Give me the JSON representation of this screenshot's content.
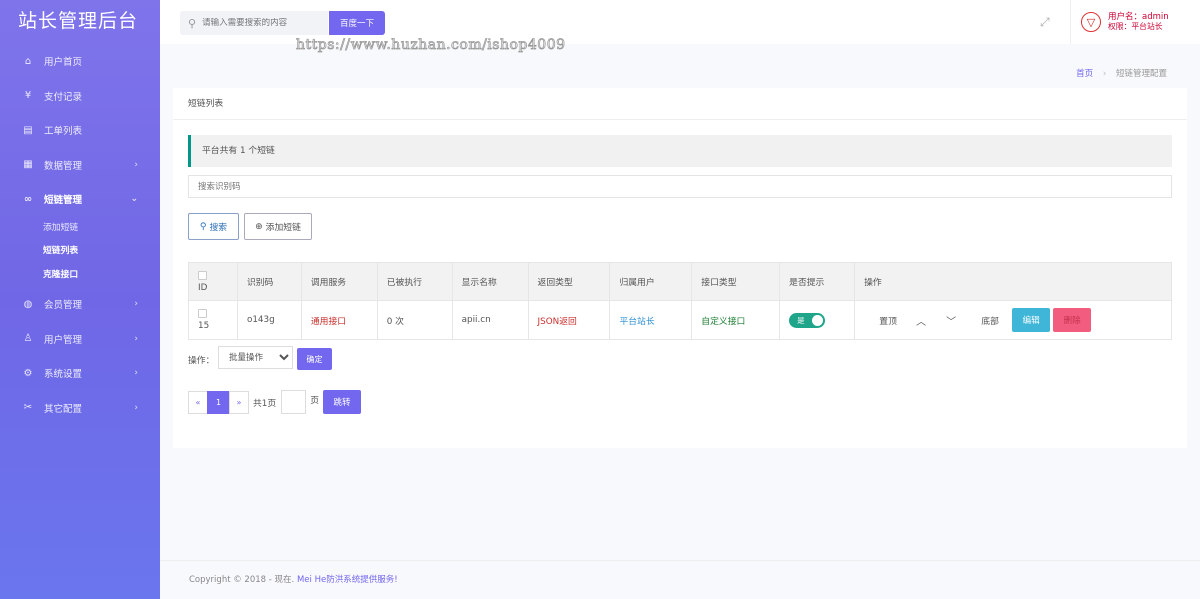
{
  "brand": "站长管理后台",
  "sidebar": {
    "items": [
      {
        "label": "用户首页",
        "icon": "home-icon"
      },
      {
        "label": "支付记录",
        "icon": "yen-icon"
      },
      {
        "label": "工单列表",
        "icon": "ticket-icon"
      },
      {
        "label": "数据管理",
        "icon": "database-icon"
      },
      {
        "label": "短链管理",
        "icon": "link-icon"
      },
      {
        "label": "会员管理",
        "icon": "globe-icon"
      },
      {
        "label": "用户管理",
        "icon": "user-icon"
      },
      {
        "label": "系统设置",
        "icon": "gear-icon"
      },
      {
        "label": "其它配置",
        "icon": "tools-icon"
      }
    ],
    "submenu": [
      "添加短链",
      "短链列表",
      "克隆接口"
    ]
  },
  "header": {
    "search_placeholder": "请输入需要搜索的内容",
    "search_button": "百度一下",
    "watermark": "https://www.huzhan.com/ishop4009",
    "user_name": "用户名：admin",
    "user_role": "权限：平台站长"
  },
  "breadcrumb": {
    "home": "首页",
    "current": "短链管理配置"
  },
  "card": {
    "title": "短链列表",
    "notice_prefix": "平台共有",
    "notice_count": "1",
    "notice_suffix": "个短链",
    "search_placeholder": "搜索识别码",
    "search_button": "搜索",
    "add_button": "添加短链"
  },
  "table": {
    "headers": [
      "ID",
      "识别码",
      "调用服务",
      "已被执行",
      "显示名称",
      "返回类型",
      "归属用户",
      "接口类型",
      "是否提示",
      "操作"
    ],
    "rows": [
      {
        "id": "15",
        "code": "o143g",
        "service": "通用接口",
        "executed": "0 次",
        "display_name": "apii.cn",
        "return_type": "JSON返回",
        "owner": "平台站长",
        "api_type": "自定义接口",
        "toggle": "是",
        "op_top": "置顶",
        "op_bottom": "底部",
        "op_edit": "编辑",
        "op_delete": "删除"
      }
    ]
  },
  "batch": {
    "label": "操作：",
    "select_value": "批量操作",
    "confirm": "确定"
  },
  "pager": {
    "prev": "«",
    "current": "1",
    "next": "»",
    "total": "共1页",
    "unit": "页",
    "jump": "跳转"
  },
  "footer": {
    "prefix": "Copyright © 2018 - 现在.",
    "link": "Mei He防洪系统提供服务!"
  }
}
